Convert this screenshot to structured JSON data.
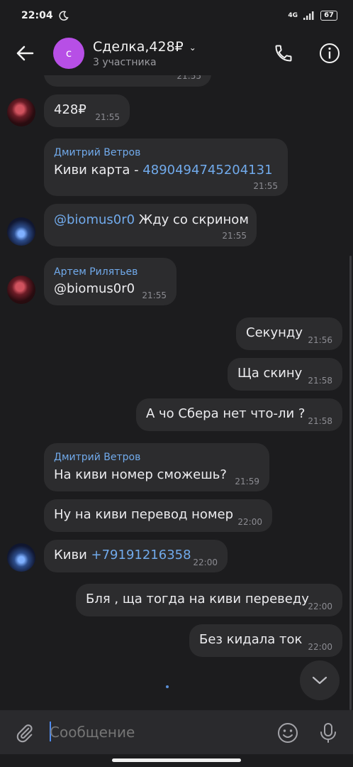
{
  "status": {
    "time": "22:04",
    "network": "4G",
    "battery": "67"
  },
  "header": {
    "title": "Сделка,428₽",
    "subtitle": "3 участника",
    "avatar_letter": "с"
  },
  "messages": [
    {
      "time": "21:55"
    },
    {
      "text": "428₽",
      "time": "21:55"
    },
    {
      "sender": "Дмитрий Ветров",
      "text": "Киви карта - ",
      "link": "4890494745204131",
      "time": "21:55"
    },
    {
      "text": "@biomus0r0 Жду со скрином",
      "time": "21:55"
    },
    {
      "sender": "Артем Рилятьев",
      "text": "@biomus0r0",
      "time": "21:55"
    },
    {
      "text": "Секунду",
      "time": "21:56"
    },
    {
      "text": "Ща скину",
      "time": "21:58"
    },
    {
      "text": "А чо Сбера нет что-ли ?",
      "time": "21:58"
    },
    {
      "sender": "Дмитрий Ветров",
      "text": "На киви номер сможешь?",
      "time": "21:59"
    },
    {
      "text": "Ну на киви перевод номер",
      "time": "22:00"
    },
    {
      "text": "Киви ",
      "link": "+79191216358",
      "time": "22:00"
    },
    {
      "text": "Бля , ща тогда на киви переведу",
      "time": "22:00"
    },
    {
      "text": "Без кидала ток",
      "time": "22:00"
    }
  ],
  "composer": {
    "placeholder": "Сообщение"
  },
  "icons": [
    "back-arrow",
    "chevron-down",
    "phone",
    "info",
    "attach",
    "emoji",
    "microphone",
    "scroll-down"
  ]
}
